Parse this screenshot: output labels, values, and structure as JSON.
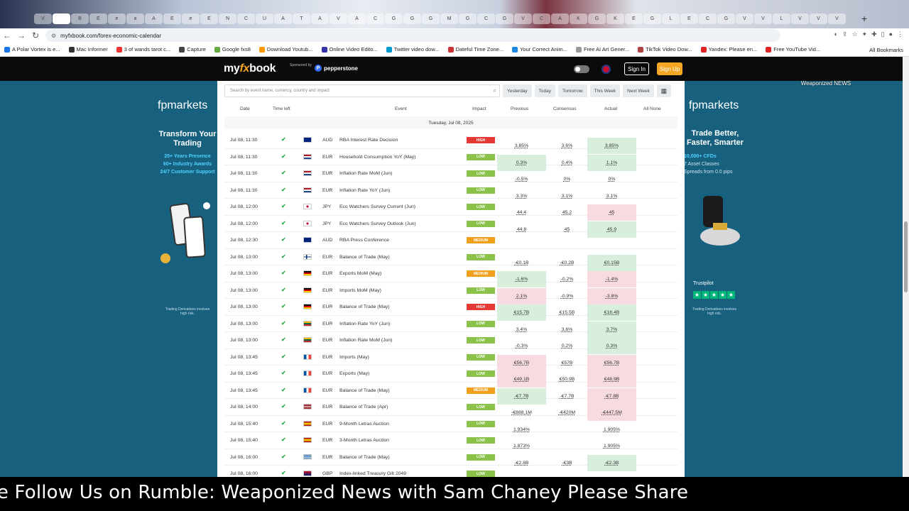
{
  "browser": {
    "url": "myfxbook.com/forex-economic-calendar",
    "tabs": [
      "V",
      "",
      "B",
      "E",
      "e",
      "a",
      "A",
      "E",
      "e",
      "E",
      "N",
      "C",
      "U",
      "A",
      "T",
      "A",
      "V",
      "A",
      "C",
      "G",
      "G",
      "G",
      "M",
      "G",
      "C",
      "G",
      "V",
      "C",
      "A",
      "K",
      "G",
      "K",
      "E",
      "G",
      "L",
      "E",
      "C",
      "G",
      "V",
      "V",
      "L",
      "V",
      "V",
      "V"
    ],
    "bookmarks": [
      "A Polar Vortex is e...",
      "Mac Informer",
      "3 of wands tarot c...",
      "Capture",
      "Google fxs8",
      "Download Youtub...",
      "Online Video Edito...",
      "Twitter video dow...",
      "Dateful Time Zone...",
      "Your Correct Anim...",
      "Free AI Art Gener...",
      "TikTok Video Dow...",
      "Yandex: Please en...",
      "Free YouTube Vid..."
    ],
    "all_bookmarks": "All Bookmarks",
    "colors": {
      "bm_icons": [
        "#1a73e8",
        "#333",
        "#e33",
        "#444",
        "#6a4",
        "#f90",
        "#33a",
        "#09c",
        "#c33",
        "#1e88e5",
        "#999",
        "#a44",
        "#d22",
        "#d22"
      ]
    }
  },
  "site": {
    "logo_my": "my",
    "logo_fx": "fx",
    "logo_book": "book",
    "sponsored_by": "Sponsored by",
    "sponsor": "pepperstone",
    "sign_in": "Sign In",
    "sign_up": "Sign Up",
    "overlay_logo": "Weaponized NEWS"
  },
  "ads": {
    "left": {
      "brand": "fpmarkets",
      "headline": "Transform Your Trading",
      "line1": "20+ Years Presence",
      "line2": "60+ Industry Awards",
      "line3": "24/7 Customer Support",
      "disclaimer": "Trading Derivatives involves high risk."
    },
    "right": {
      "brand": "fpmarkets",
      "headline": "Trade Better, Faster, Smarter",
      "line1": "10,000+ CFDs",
      "line2": "7 Asset Classes",
      "line3": "Spreads from 0.0 pips",
      "trustpilot": "Trustpilot",
      "disclaimer": "Trading Derivatives involves high risk."
    }
  },
  "calendar": {
    "search_placeholder": "Search by event name, currency, country and impact",
    "filters": [
      "Yesterday",
      "Today",
      "Tomorrow",
      "This Week",
      "Next Week"
    ],
    "columns": {
      "date": "Date",
      "time_left": "Time left",
      "event": "Event",
      "impact": "Impact",
      "previous": "Previous",
      "consensus": "Consensus",
      "actual": "Actual",
      "all": "All None"
    },
    "day_header": "Tuesday, Jul 08, 2025",
    "rows": [
      {
        "date": "Jul 08, 11:30",
        "flag": "au",
        "cur": "AUD",
        "event": "RBA Interest Rate Decision",
        "impact": "HIGH",
        "prev": "3.85%",
        "cons": "3.6%",
        "act": "3.85%",
        "prev_bg": "",
        "act_bg": "g"
      },
      {
        "date": "Jul 08, 11:30",
        "flag": "nl",
        "cur": "EUR",
        "event": "Household Consumption YoY (May)",
        "impact": "LOW",
        "prev": "0.3%",
        "cons": "0.4%",
        "act": "1.1%",
        "prev_bg": "g",
        "act_bg": "g"
      },
      {
        "date": "Jul 08, 11:30",
        "flag": "nl",
        "cur": "EUR",
        "event": "Inflation Rate MoM (Jun)",
        "impact": "LOW",
        "prev": "-0.5%",
        "cons": "0%",
        "act": "0%",
        "prev_bg": "",
        "act_bg": ""
      },
      {
        "date": "Jul 08, 11:30",
        "flag": "nl",
        "cur": "EUR",
        "event": "Inflation Rate YoY (Jun)",
        "impact": "LOW",
        "prev": "3.3%",
        "cons": "3.1%",
        "act": "3.1%",
        "prev_bg": "",
        "act_bg": ""
      },
      {
        "date": "Jul 08, 12:00",
        "flag": "jp",
        "cur": "JPY",
        "event": "Eco Watchers Survey Current (Jun)",
        "impact": "LOW",
        "prev": "44.4",
        "cons": "45.2",
        "act": "45",
        "prev_bg": "",
        "act_bg": "r"
      },
      {
        "date": "Jul 08, 12:00",
        "flag": "jp",
        "cur": "JPY",
        "event": "Eco Watchers Survey Outlook (Jun)",
        "impact": "LOW",
        "prev": "44.8",
        "cons": "45",
        "act": "45.9",
        "prev_bg": "",
        "act_bg": "g"
      },
      {
        "date": "Jul 08, 12:30",
        "flag": "au",
        "cur": "AUD",
        "event": "RBA Press Conference",
        "impact": "MEDIUM",
        "prev": "",
        "cons": "",
        "act": "",
        "prev_bg": "",
        "act_bg": ""
      },
      {
        "date": "Jul 08, 13:00",
        "flag": "fi",
        "cur": "EUR",
        "event": "Balance of Trade (May)",
        "impact": "LOW",
        "prev": "-€0.1B",
        "cons": "-€0.2B",
        "act": "€0.15B",
        "prev_bg": "",
        "act_bg": "g"
      },
      {
        "date": "Jul 08, 13:00",
        "flag": "de",
        "cur": "EUR",
        "event": "Exports MoM (May)",
        "impact": "MEDIUM",
        "prev": "-1.6%",
        "cons": "-0.2%",
        "act": "-1.4%",
        "prev_bg": "g",
        "act_bg": "r"
      },
      {
        "date": "Jul 08, 13:00",
        "flag": "de",
        "cur": "EUR",
        "event": "Imports MoM (May)",
        "impact": "LOW",
        "prev": "2.1%",
        "cons": "-0.9%",
        "act": "-3.8%",
        "prev_bg": "r",
        "act_bg": "r"
      },
      {
        "date": "Jul 08, 13:00",
        "flag": "de",
        "cur": "EUR",
        "event": "Balance of Trade (May)",
        "impact": "HIGH",
        "prev": "€15.7B",
        "cons": "€15.5B",
        "act": "€18.4B",
        "prev_bg": "g",
        "act_bg": "g"
      },
      {
        "date": "Jul 08, 13:00",
        "flag": "lt",
        "cur": "EUR",
        "event": "Inflation Rate YoY (Jun)",
        "impact": "LOW",
        "prev": "3.4%",
        "cons": "3.6%",
        "act": "3.7%",
        "prev_bg": "",
        "act_bg": "g"
      },
      {
        "date": "Jul 08, 13:00",
        "flag": "lt",
        "cur": "EUR",
        "event": "Inflation Rate MoM (Jun)",
        "impact": "LOW",
        "prev": "-0.3%",
        "cons": "0.2%",
        "act": "0.3%",
        "prev_bg": "",
        "act_bg": "g"
      },
      {
        "date": "Jul 08, 13:45",
        "flag": "fr",
        "cur": "EUR",
        "event": "Imports (May)",
        "impact": "LOW",
        "prev": "€56.7B",
        "cons": "€57B",
        "act": "€56.7B",
        "prev_bg": "r",
        "act_bg": "r"
      },
      {
        "date": "Jul 08, 13:45",
        "flag": "fr",
        "cur": "EUR",
        "event": "Exports (May)",
        "impact": "LOW",
        "prev": "€49.1B",
        "cons": "€50.9B",
        "act": "€48.9B",
        "prev_bg": "r",
        "act_bg": "r"
      },
      {
        "date": "Jul 08, 13:45",
        "flag": "fr",
        "cur": "EUR",
        "event": "Balance of Trade (May)",
        "impact": "MEDIUM",
        "prev": "-€7.7B",
        "cons": "-€7.7B",
        "act": "-€7.8B",
        "prev_bg": "g",
        "act_bg": "r"
      },
      {
        "date": "Jul 08, 14:00",
        "flag": "lv",
        "cur": "EUR",
        "event": "Balance of Trade (Apr)",
        "impact": "LOW",
        "prev": "-€888.1M",
        "cons": "-€420M",
        "act": "-€447.5M",
        "prev_bg": "",
        "act_bg": "r"
      },
      {
        "date": "Jul 08, 15:40",
        "flag": "es",
        "cur": "EUR",
        "event": "9-Month Letras Auction",
        "impact": "LOW",
        "prev": "1.934%",
        "cons": "",
        "act": "1.905%",
        "prev_bg": "",
        "act_bg": ""
      },
      {
        "date": "Jul 08, 15:40",
        "flag": "es",
        "cur": "EUR",
        "event": "3-Month Letras Auction",
        "impact": "LOW",
        "prev": "1.873%",
        "cons": "",
        "act": "1.905%",
        "prev_bg": "",
        "act_bg": ""
      },
      {
        "date": "Jul 08, 16:00",
        "flag": "gr",
        "cur": "EUR",
        "event": "Balance of Trade (May)",
        "impact": "LOW",
        "prev": "-€2.8B",
        "cons": "-€3B",
        "act": "-€2.3B",
        "prev_bg": "",
        "act_bg": "g"
      },
      {
        "date": "Jul 08, 16:00",
        "flag": "gb",
        "cur": "GBP",
        "event": "Index-linked Treasury Gilt 2049",
        "impact": "LOW",
        "prev": "",
        "cons": "",
        "act": "2.36",
        "prev_bg": "",
        "act_bg": ""
      }
    ]
  },
  "ticker": "Share    Follow Us on Rumble: Weaponized News with Sam Chaney Please Share"
}
